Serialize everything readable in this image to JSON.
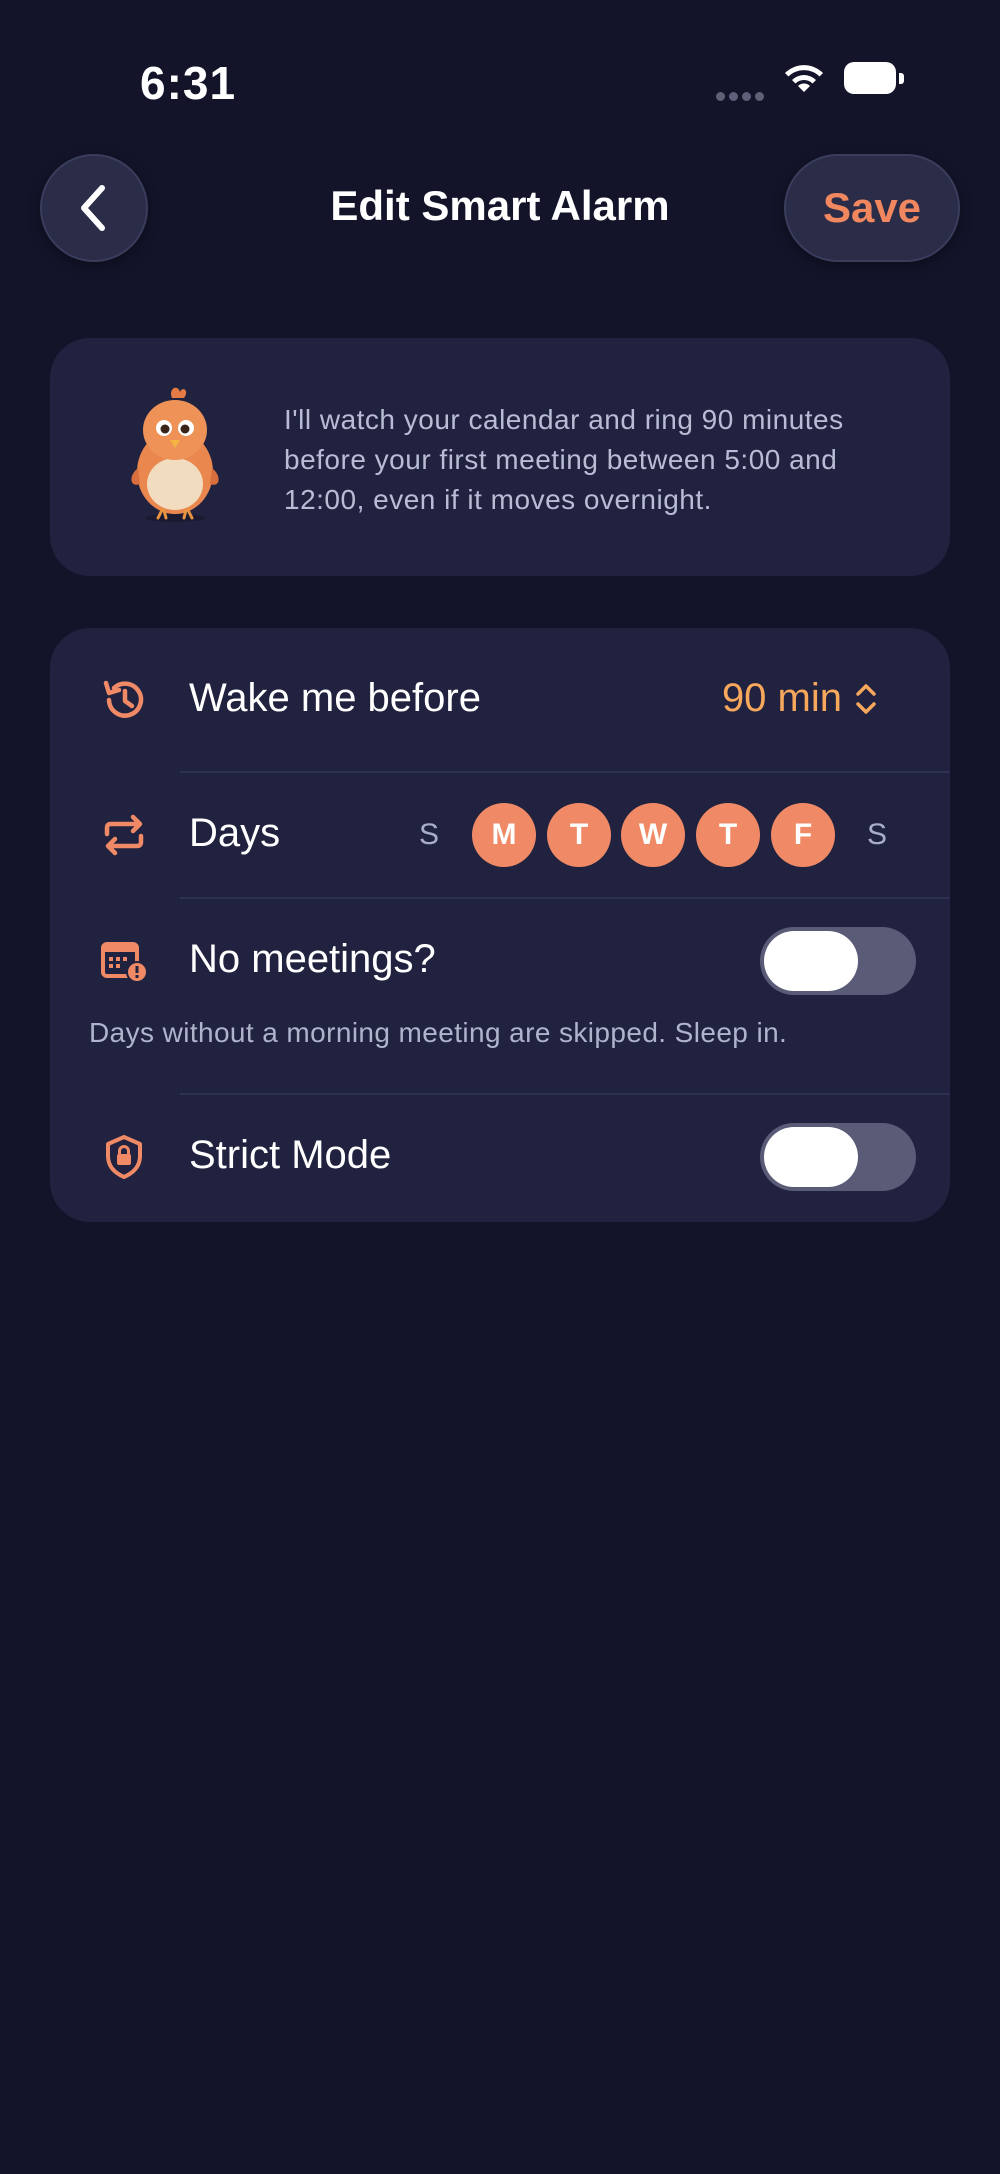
{
  "status_bar": {
    "time": "6:31"
  },
  "header": {
    "title": "Edit Smart Alarm",
    "save_label": "Save"
  },
  "mascot_card": {
    "message": "I'll watch your calendar and ring 90 minutes before your first meeting between 5:00 and 12:00, even if it moves overnight."
  },
  "settings": {
    "wake": {
      "label": "Wake me before",
      "value": "90 min"
    },
    "days": {
      "label": "Days",
      "items": [
        {
          "letter": "S",
          "selected": false
        },
        {
          "letter": "M",
          "selected": true
        },
        {
          "letter": "T",
          "selected": true
        },
        {
          "letter": "W",
          "selected": true
        },
        {
          "letter": "T",
          "selected": true
        },
        {
          "letter": "F",
          "selected": true
        },
        {
          "letter": "S",
          "selected": false
        }
      ]
    },
    "no_meetings": {
      "label": "No meetings?",
      "enabled": false,
      "helper": "Days without a morning meeting are skipped. Sleep in."
    },
    "strict_mode": {
      "label": "Strict Mode",
      "enabled": false
    }
  },
  "colors": {
    "background": "#13142a",
    "card": "#21223f",
    "accent": "#f08a66",
    "value_accent": "#f7a85c"
  }
}
